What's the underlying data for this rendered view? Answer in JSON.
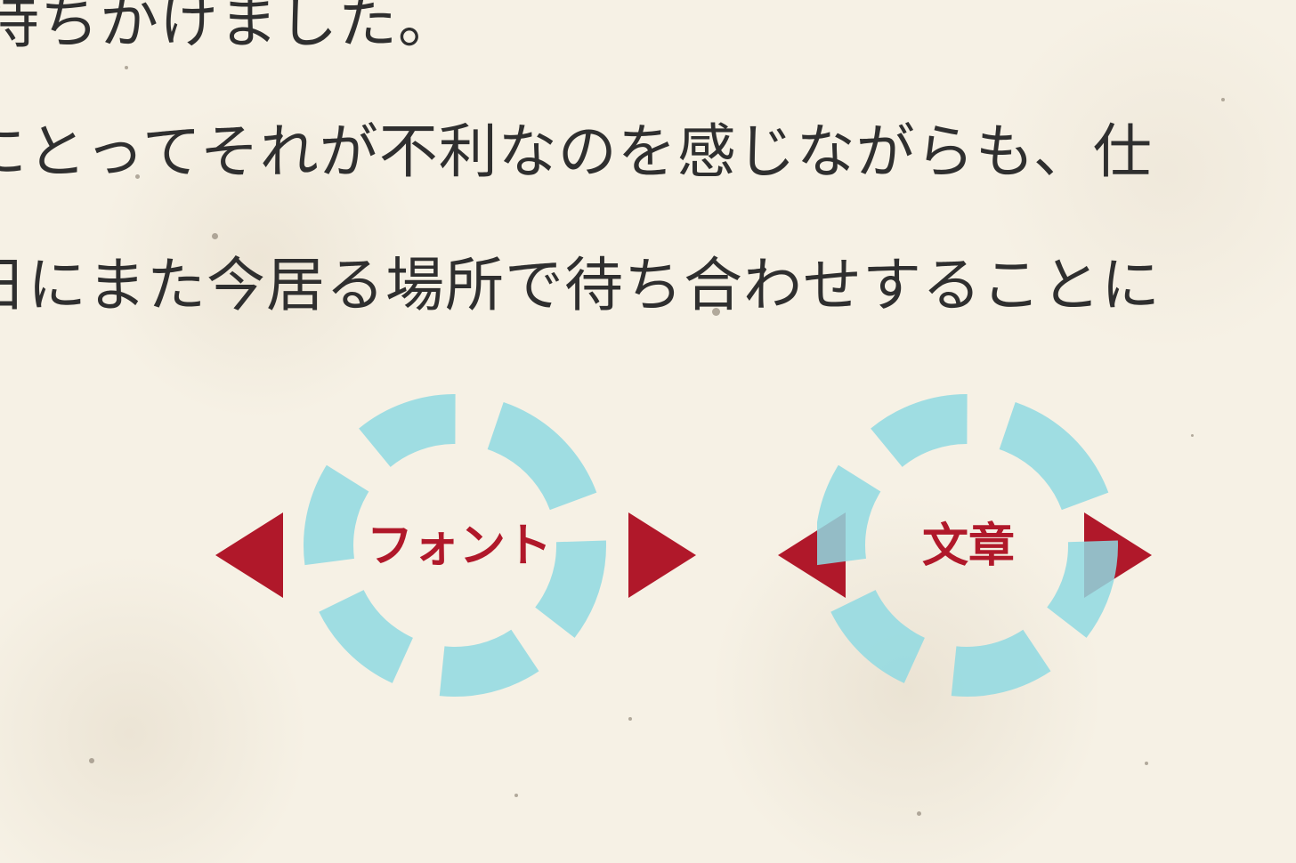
{
  "reader": {
    "lines": [
      "待ちかけました。",
      "にとってそれが不利なのを感じながらも、仕",
      "日にまた今居る場所で待ち合わせすることに"
    ]
  },
  "settings": {
    "font": {
      "label": "フォント"
    },
    "text": {
      "label": "文章"
    }
  },
  "colors": {
    "background": "#f6f1e5",
    "text": "#2f2f2f",
    "accent": "#b0182a",
    "dial": "#8fd9e2"
  },
  "icons": {
    "prev": "triangle-left-icon",
    "next": "triangle-right-icon",
    "dial": "dashed-circle-icon"
  }
}
